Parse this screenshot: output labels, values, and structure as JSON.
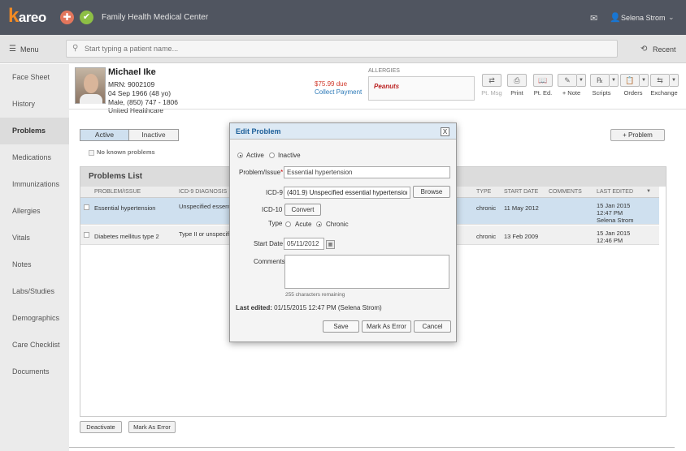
{
  "app": {
    "logo": "kareo",
    "practice_name": "Family Health Medical Center",
    "user_name": "Selena Strom"
  },
  "subbar": {
    "menu_label": "Menu",
    "search_placeholder": "Start typing a patient name...",
    "recent_label": "Recent"
  },
  "sidebar": {
    "items": [
      {
        "label": "Face Sheet"
      },
      {
        "label": "History"
      },
      {
        "label": "Problems",
        "active": true
      },
      {
        "label": "Medications"
      },
      {
        "label": "Immunizations"
      },
      {
        "label": "Allergies"
      },
      {
        "label": "Vitals"
      },
      {
        "label": "Notes"
      },
      {
        "label": "Labs/Studies"
      },
      {
        "label": "Demographics"
      },
      {
        "label": "Care Checklist"
      },
      {
        "label": "Documents"
      }
    ]
  },
  "patient": {
    "name": "Michael Ike",
    "mrn": "MRN: 9002109",
    "dob": "04 Sep 1966 (48 yo)",
    "sex_phone": "Male, (850) 747 - 1806",
    "insurance": "United Healthcare",
    "due": "$75.99 due",
    "collect_payment": "Collect Payment",
    "allergies_label": "Allergies",
    "allergies": [
      "Peanuts"
    ]
  },
  "toolbar": {
    "pt_msg": "Pt. Msg",
    "print": "Print",
    "pt_ed": "Pt. Ed.",
    "note": "+ Note",
    "scripts": "Scripts",
    "orders": "Orders",
    "exchange": "Exchange"
  },
  "problems": {
    "tab_active": "Active",
    "tab_inactive": "Inactive",
    "no_known": "No known problems",
    "add_button": "+ Problem",
    "list_title": "Problems List",
    "columns": {
      "problem": "Problem/Issue",
      "icd9": "ICD-9 Diagnosis",
      "type": "Type",
      "start_date": "Start Date",
      "comments": "Comments",
      "last_edited": "Last Edited"
    },
    "rows": [
      {
        "problem": "Essential hypertension",
        "icd9": "Unspecified essenti",
        "type": "chronic",
        "start_date": "11 May 2012",
        "last_edited_1": "15 Jan 2015",
        "last_edited_2": "12:47 PM",
        "last_edited_3": "Selena Strom"
      },
      {
        "problem": "Diabetes mellitus type 2",
        "icd9": "Type II or unspecifi",
        "type": "chronic",
        "start_date": "13 Feb 2009",
        "last_edited_1": "15 Jan 2015",
        "last_edited_2": "12:46 PM",
        "last_edited_3": ""
      }
    ],
    "deactivate": "Deactivate",
    "mark_error": "Mark As Error"
  },
  "modal": {
    "title": "Edit Problem",
    "close": "X",
    "status_active": "Active",
    "status_inactive": "Inactive",
    "problem_label": "Problem/Issue",
    "problem_value": "Essential hypertension",
    "icd9_label": "ICD-9",
    "icd9_value": "(401.9) Unspecified essential hypertension",
    "browse": "Browse",
    "icd10_label": "ICD-10",
    "convert": "Convert",
    "type_label": "Type",
    "type_acute": "Acute",
    "type_chronic": "Chronic",
    "start_date_label": "Start Date",
    "start_date_value": "05/11/2012",
    "comments_label": "Comments",
    "chars_remaining": "255 characters remaining",
    "last_edited_label": "Last edited:",
    "last_edited_value": "01/15/2015 12:47 PM (Selena Strom)",
    "save": "Save",
    "mark_error": "Mark As Error",
    "cancel": "Cancel"
  }
}
